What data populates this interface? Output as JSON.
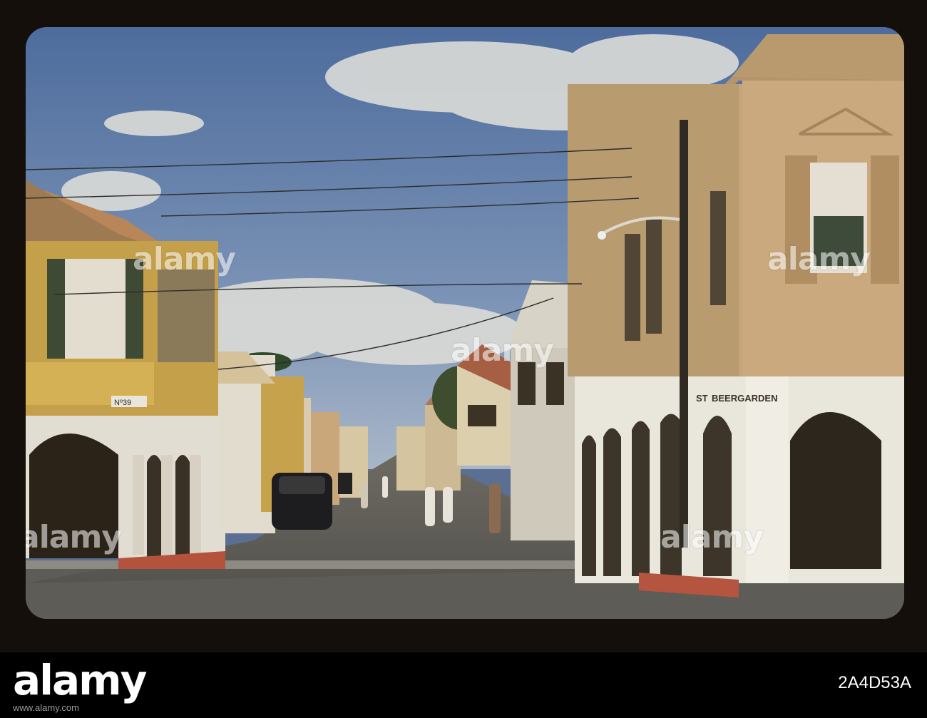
{
  "photo": {
    "sign_beergarden": "BEERGARDEN",
    "sign_st": "ST",
    "sign_number": "Nº39"
  },
  "watermark": {
    "text": "alamy"
  },
  "banner": {
    "logo": "alamy",
    "image_id": "2A4D53A",
    "caption": "www.alamy.com"
  },
  "colors": {
    "sky": "#5b7aa8",
    "road": "#5f5d57",
    "left_building": "#c4a248",
    "right_building": "#b89a6a",
    "arcade_white": "#e8e4da",
    "curb": "#b7533c"
  }
}
